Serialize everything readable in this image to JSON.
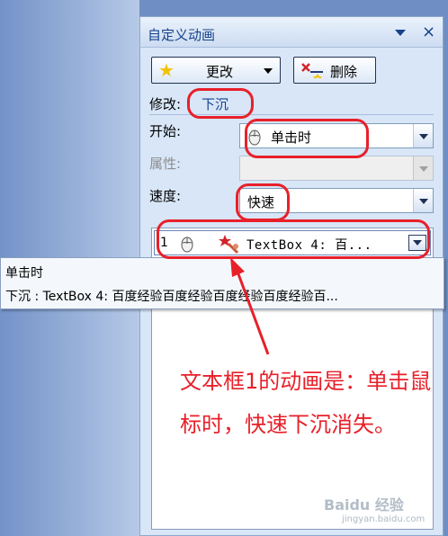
{
  "panel": {
    "title": "自定义动画",
    "close": "×",
    "change_button": "更改",
    "delete_button": "删除"
  },
  "modify": {
    "label": "修改:",
    "value": "下沉"
  },
  "fields": {
    "start_label": "开始:",
    "start_value": "单击时",
    "property_label": "属性:",
    "property_value": "",
    "speed_label": "速度:",
    "speed_value": "快速"
  },
  "list": {
    "items": [
      {
        "number": "1",
        "text": "TextBox 4: 百..."
      }
    ]
  },
  "tooltip": {
    "line1": "单击时",
    "line2": "下沉 : TextBox 4: 百度经验百度经验百度经验百度经验百..."
  },
  "annotation": {
    "text": "文本框1的动画是：单击鼠标时，快速下沉消失。",
    "color": "#e8202a"
  },
  "watermark": {
    "brand": "Baidu 经验",
    "url": "jingyan.baidu.com"
  },
  "icons": {
    "change": "star-icon",
    "delete": "delete-icon",
    "trigger": "mouse-icon",
    "effect": "exit-animation-icon"
  }
}
